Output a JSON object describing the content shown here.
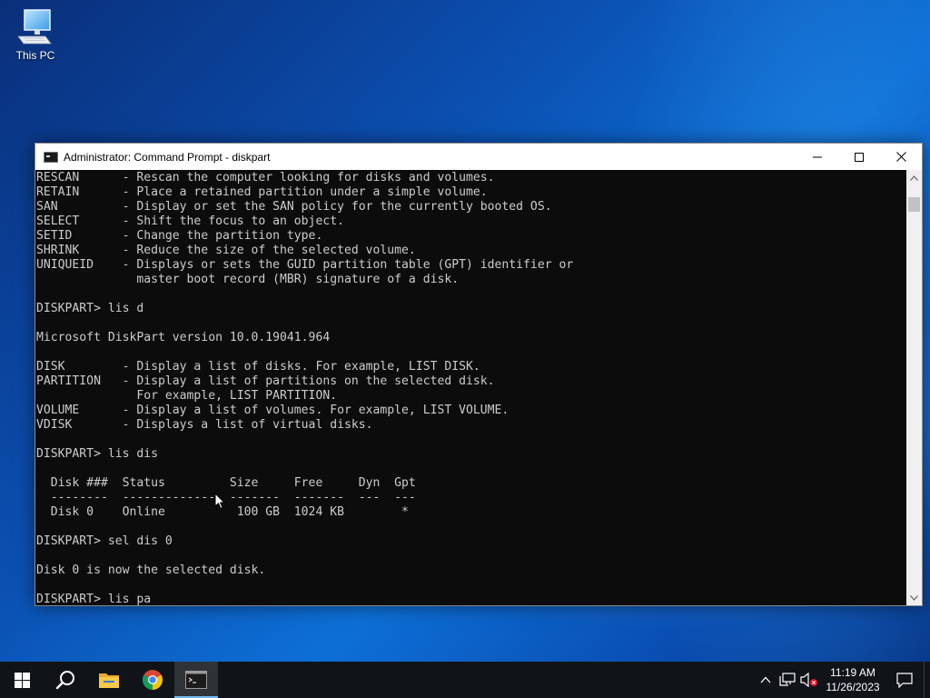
{
  "desktop": {
    "icons": [
      {
        "label": "This PC",
        "icon": "this-pc-icon"
      }
    ]
  },
  "window": {
    "title": "Administrator: Command Prompt - diskpart",
    "controls": [
      "minimize-icon",
      "maximize-icon",
      "close-icon"
    ],
    "console_lines": [
      "RESCAN      - Rescan the computer looking for disks and volumes.",
      "RETAIN      - Place a retained partition under a simple volume.",
      "SAN         - Display or set the SAN policy for the currently booted OS.",
      "SELECT      - Shift the focus to an object.",
      "SETID       - Change the partition type.",
      "SHRINK      - Reduce the size of the selected volume.",
      "UNIQUEID    - Displays or sets the GUID partition table (GPT) identifier or",
      "              master boot record (MBR) signature of a disk.",
      "",
      "DISKPART> lis d",
      "",
      "Microsoft DiskPart version 10.0.19041.964",
      "",
      "DISK        - Display a list of disks. For example, LIST DISK.",
      "PARTITION   - Display a list of partitions on the selected disk.",
      "              For example, LIST PARTITION.",
      "VOLUME      - Display a list of volumes. For example, LIST VOLUME.",
      "VDISK       - Displays a list of virtual disks.",
      "",
      "DISKPART> lis dis",
      "",
      "  Disk ###  Status         Size     Free     Dyn  Gpt",
      "  --------  -------------  -------  -------  ---  ---",
      "  Disk 0    Online          100 GB  1024 KB        *",
      "",
      "DISKPART> sel dis 0",
      "",
      "Disk 0 is now the selected disk.",
      "",
      "DISKPART> lis pa"
    ]
  },
  "taskbar": {
    "buttons": [
      {
        "name": "start-button",
        "icon": "windows-logo-icon"
      },
      {
        "name": "search-button",
        "icon": "search-icon"
      },
      {
        "name": "file-explorer-button",
        "icon": "folder-icon"
      },
      {
        "name": "chrome-button",
        "icon": "chrome-icon"
      },
      {
        "name": "command-prompt-button",
        "icon": "cmd-icon",
        "active": true
      }
    ],
    "tray": {
      "icons": [
        "chevron-up-icon",
        "network-icon",
        "volume-muted-icon"
      ],
      "time": "11:19 AM",
      "date": "11/26/2023",
      "notification_icon": "notification-icon"
    }
  },
  "colors": {
    "console_bg": "#0c0c0c",
    "console_fg": "#cccccc",
    "taskbar_bg": "#101418",
    "taskbar_active_accent": "#76b9ed"
  }
}
